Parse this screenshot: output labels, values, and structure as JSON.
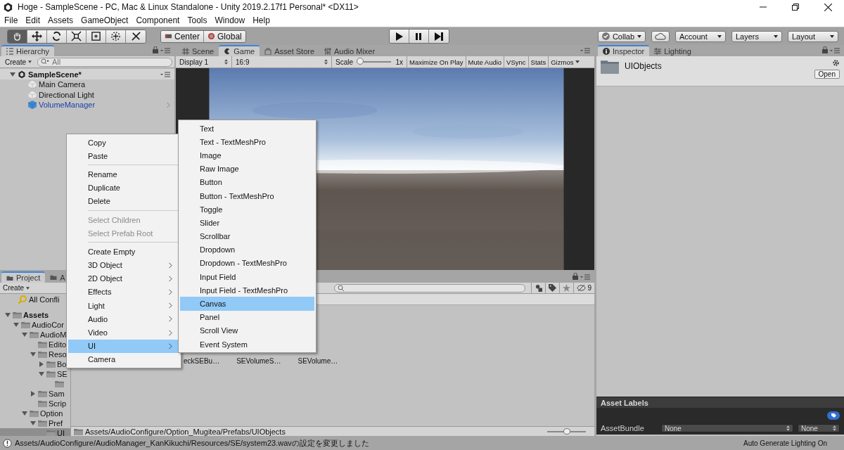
{
  "window": {
    "title": "Hoge - SampleScene - PC, Mac & Linux Standalone - Unity 2019.2.17f1 Personal* <DX11>"
  },
  "menu_bar": [
    "File",
    "Edit",
    "Assets",
    "GameObject",
    "Component",
    "Tools",
    "Window",
    "Help"
  ],
  "toolbar": {
    "tools": [
      {
        "kind": "hand",
        "selected": true
      },
      {
        "kind": "move",
        "selected": false
      },
      {
        "kind": "rotate",
        "selected": false
      },
      {
        "kind": "scale",
        "selected": false
      },
      {
        "kind": "rect",
        "selected": false
      },
      {
        "kind": "transform",
        "selected": false
      },
      {
        "kind": "custom",
        "selected": false
      }
    ],
    "pivot": "Center",
    "space": "Global",
    "collab": "Collab",
    "account": "Account",
    "layers": "Layers",
    "layout": "Layout"
  },
  "hierarchy": {
    "tab": "Hierarchy",
    "create": "Create",
    "search": {
      "placeholder": "All"
    },
    "scene": "SampleScene*",
    "items": [
      {
        "label": "Main Camera",
        "prefab": false
      },
      {
        "label": "Directional Light",
        "prefab": false
      },
      {
        "label": "VolumeManager",
        "prefab": true
      }
    ]
  },
  "game": {
    "tabs": [
      {
        "kind": "scene",
        "label": "Scene",
        "selected": false
      },
      {
        "kind": "game",
        "label": "Game",
        "selected": true
      },
      {
        "kind": "store",
        "label": "Asset Store",
        "selected": false
      },
      {
        "kind": "mixer",
        "label": "Audio Mixer",
        "selected": false
      }
    ],
    "display": "Display 1",
    "aspect": "16:9",
    "scale_label": "Scale",
    "scale": {
      "level": 0.05
    },
    "scale_reading": "1x",
    "toggles": [
      "Maximize On Play",
      "Mute Audio",
      "VSync",
      "Stats"
    ],
    "gizmos": "Gizmos"
  },
  "project": {
    "tabs": [
      {
        "label": "Project",
        "selected": true
      },
      {
        "label": "A",
        "selected": false
      }
    ],
    "create": "Create",
    "favorite": "All Confli",
    "tree": [
      {
        "label": "Assets",
        "bold": true,
        "expanded": true,
        "selected": false,
        "children": [
          {
            "label": "AudioCor",
            "expanded": true,
            "selected": false,
            "children": [
              {
                "label": "AudioM",
                "expanded": true,
                "selected": false,
                "children": [
                  {
                    "label": "Edito",
                    "selected": false
                  },
                  {
                    "label": "Reso",
                    "expanded": true,
                    "selected": false,
                    "children": [
                      {
                        "label": "Bo",
                        "expanded": false,
                        "selected": false
                      },
                      {
                        "label": "SE",
                        "expanded": true,
                        "selected": false,
                        "children": [
                          {
                            "selected": false
                          }
                        ]
                      }
                    ]
                  },
                  {
                    "label": "Sam",
                    "expanded": false,
                    "selected": false
                  },
                  {
                    "label": "Scrip",
                    "selected": false
                  }
                ]
              },
              {
                "label": "Option",
                "expanded": true,
                "selected": false,
                "children": [
                  {
                    "label": "Pref",
                    "expanded": true,
                    "selected": false,
                    "children": [
                      {
                        "label": "UI",
                        "selected": true
                      }
                    ]
                  }
                ]
              }
            ]
          }
        ]
      }
    ],
    "hidden_count": "9",
    "files": [
      "eckSEBu…",
      "SEVolumeS…",
      "SEVolume…"
    ],
    "path": "Assets/AudioConfigure/Option_Mugitea/Prefabs/UIObjects",
    "zoom": {
      "level": 0.5
    }
  },
  "inspector": {
    "tabs": [
      {
        "label": "Inspector",
        "selected": true
      },
      {
        "label": "Lighting",
        "selected": false
      }
    ],
    "asset_name": "UIObjects",
    "open": "Open",
    "labels_title": "Asset Labels",
    "bundle_label": "AssetBundle",
    "bundle": "None",
    "variant": "None"
  },
  "context_menu": {
    "items": [
      {
        "kind": "item",
        "label": "Copy",
        "disabled": false,
        "submenu": false,
        "selected": false
      },
      {
        "kind": "item",
        "label": "Paste",
        "disabled": false,
        "submenu": false,
        "selected": false
      },
      {
        "kind": "separator"
      },
      {
        "kind": "item",
        "label": "Rename",
        "disabled": false,
        "submenu": false,
        "selected": false
      },
      {
        "kind": "item",
        "label": "Duplicate",
        "disabled": false,
        "submenu": false,
        "selected": false
      },
      {
        "kind": "item",
        "label": "Delete",
        "disabled": false,
        "submenu": false,
        "selected": false
      },
      {
        "kind": "separator"
      },
      {
        "kind": "item",
        "label": "Select Children",
        "disabled": true,
        "submenu": false,
        "selected": false
      },
      {
        "kind": "item",
        "label": "Select Prefab Root",
        "disabled": true,
        "submenu": false,
        "selected": false
      },
      {
        "kind": "separator"
      },
      {
        "kind": "item",
        "label": "Create Empty",
        "disabled": false,
        "submenu": false,
        "selected": false
      },
      {
        "kind": "item",
        "label": "3D Object",
        "disabled": false,
        "submenu": true,
        "selected": false
      },
      {
        "kind": "item",
        "label": "2D Object",
        "disabled": false,
        "submenu": true,
        "selected": false
      },
      {
        "kind": "item",
        "label": "Effects",
        "disabled": false,
        "submenu": true,
        "selected": false
      },
      {
        "kind": "item",
        "label": "Light",
        "disabled": false,
        "submenu": true,
        "selected": false
      },
      {
        "kind": "item",
        "label": "Audio",
        "disabled": false,
        "submenu": true,
        "selected": false
      },
      {
        "kind": "item",
        "label": "Video",
        "disabled": false,
        "submenu": true,
        "selected": false
      },
      {
        "kind": "item",
        "label": "UI",
        "disabled": false,
        "submenu": true,
        "selected": true
      },
      {
        "kind": "item",
        "label": "Camera",
        "disabled": false,
        "submenu": false,
        "selected": false
      }
    ]
  },
  "submenu": {
    "items": [
      {
        "label": "Text",
        "selected": false
      },
      {
        "label": "Text - TextMeshPro",
        "selected": false
      },
      {
        "label": "Image",
        "selected": false
      },
      {
        "label": "Raw Image",
        "selected": false
      },
      {
        "label": "Button",
        "selected": false
      },
      {
        "label": "Button - TextMeshPro",
        "selected": false
      },
      {
        "label": "Toggle",
        "selected": false
      },
      {
        "label": "Slider",
        "selected": false
      },
      {
        "label": "Scrollbar",
        "selected": false
      },
      {
        "label": "Dropdown",
        "selected": false
      },
      {
        "label": "Dropdown - TextMeshPro",
        "selected": false
      },
      {
        "label": "Input Field",
        "selected": false
      },
      {
        "label": "Input Field - TextMeshPro",
        "selected": false
      },
      {
        "label": "Canvas",
        "selected": true
      },
      {
        "label": "Panel",
        "selected": false
      },
      {
        "label": "Scroll View",
        "selected": false
      },
      {
        "label": "Event System",
        "selected": false
      }
    ]
  },
  "status_bar": {
    "message": "Assets/AudioConfigure/AudioManager_KanKikuchi/Resources/SE/system23.wavの設定を変更しました",
    "lighting": "Auto Generate Lighting On"
  }
}
